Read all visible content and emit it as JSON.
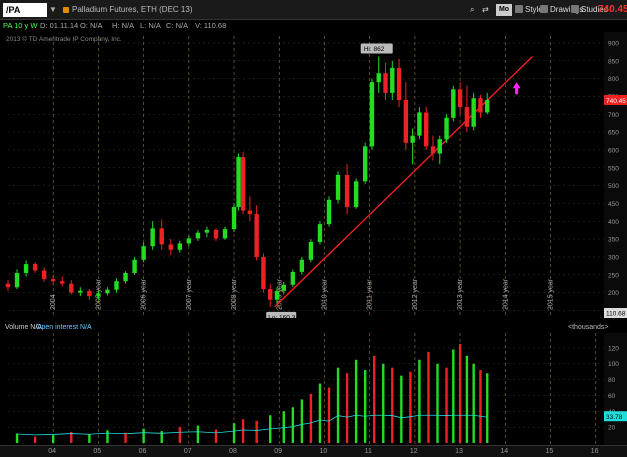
{
  "toolbar": {
    "symbol": "/PA",
    "title": "Palladium Futures, ETH (DEC 13)",
    "mo_label": "Mo",
    "style_label": "Style",
    "drawings_label": "Drawings",
    "studies_label": "Studies",
    "last_price": "740.45"
  },
  "info": {
    "period": "PA 10 y W",
    "date": "D: 01.11.14",
    "open": "O: N/A",
    "high": "H: N/A",
    "low": "L: N/A",
    "close": "C: N/A",
    "volume": "V: 110.68"
  },
  "copyright": "2013 © TD Ameritrade IP Company, Inc.",
  "colors": {
    "up": "#22dd22",
    "down": "#ee2222",
    "trendline": "#ff2222",
    "grid": "#8a6a2a",
    "arrow": "#ff22ff",
    "oi": "#22dddd"
  },
  "icons": [
    "search-icon",
    "share-icon",
    "style-icon",
    "drawings-icon",
    "studies-icon",
    "up-arrow-icon"
  ],
  "chart_data": [
    {
      "type": "candlestick",
      "x_labels": [
        "2004",
        "2005 year",
        "2006 year",
        "2007 year",
        "2008 year",
        "2009 year",
        "2010 year",
        "2011 year",
        "2012 year",
        "2013 year",
        "2014 year",
        "2015 year"
      ],
      "y_ticks": [
        900,
        850,
        800,
        750,
        700,
        650,
        600,
        550,
        500,
        450,
        400,
        350,
        300,
        250,
        200,
        150
      ],
      "ylim": [
        140,
        925
      ],
      "annotations": {
        "high": "Hi: 862",
        "low": "Lo: 160.3",
        "current": "740.45",
        "last_volume": "110.68"
      },
      "trendline": {
        "from": [
          2008.9,
          160
        ],
        "to": [
          2014.6,
          862
        ]
      },
      "candles": [
        {
          "t": 2003.0,
          "o": 225,
          "h": 235,
          "l": 205,
          "c": 215
        },
        {
          "t": 2003.2,
          "o": 215,
          "h": 265,
          "l": 210,
          "c": 255
        },
        {
          "t": 2003.4,
          "o": 255,
          "h": 290,
          "l": 245,
          "c": 280
        },
        {
          "t": 2003.6,
          "o": 280,
          "h": 285,
          "l": 255,
          "c": 262
        },
        {
          "t": 2003.8,
          "o": 262,
          "h": 270,
          "l": 230,
          "c": 238
        },
        {
          "t": 2004.0,
          "o": 238,
          "h": 250,
          "l": 220,
          "c": 232
        },
        {
          "t": 2004.2,
          "o": 232,
          "h": 245,
          "l": 218,
          "c": 225
        },
        {
          "t": 2004.4,
          "o": 225,
          "h": 235,
          "l": 195,
          "c": 200
        },
        {
          "t": 2004.6,
          "o": 200,
          "h": 215,
          "l": 190,
          "c": 205
        },
        {
          "t": 2004.8,
          "o": 205,
          "h": 210,
          "l": 180,
          "c": 190
        },
        {
          "t": 2005.0,
          "o": 190,
          "h": 205,
          "l": 180,
          "c": 198
        },
        {
          "t": 2005.2,
          "o": 198,
          "h": 215,
          "l": 192,
          "c": 208
        },
        {
          "t": 2005.4,
          "o": 208,
          "h": 240,
          "l": 200,
          "c": 232
        },
        {
          "t": 2005.6,
          "o": 232,
          "h": 260,
          "l": 225,
          "c": 255
        },
        {
          "t": 2005.8,
          "o": 255,
          "h": 300,
          "l": 250,
          "c": 292
        },
        {
          "t": 2006.0,
          "o": 292,
          "h": 340,
          "l": 285,
          "c": 330
        },
        {
          "t": 2006.2,
          "o": 330,
          "h": 400,
          "l": 320,
          "c": 380
        },
        {
          "t": 2006.4,
          "o": 380,
          "h": 405,
          "l": 320,
          "c": 335
        },
        {
          "t": 2006.6,
          "o": 335,
          "h": 350,
          "l": 305,
          "c": 320
        },
        {
          "t": 2006.8,
          "o": 320,
          "h": 345,
          "l": 312,
          "c": 338
        },
        {
          "t": 2007.0,
          "o": 338,
          "h": 360,
          "l": 330,
          "c": 352
        },
        {
          "t": 2007.2,
          "o": 352,
          "h": 375,
          "l": 345,
          "c": 368
        },
        {
          "t": 2007.4,
          "o": 368,
          "h": 385,
          "l": 355,
          "c": 376
        },
        {
          "t": 2007.6,
          "o": 376,
          "h": 380,
          "l": 345,
          "c": 352
        },
        {
          "t": 2007.8,
          "o": 352,
          "h": 385,
          "l": 348,
          "c": 378
        },
        {
          "t": 2008.0,
          "o": 378,
          "h": 450,
          "l": 370,
          "c": 440
        },
        {
          "t": 2008.1,
          "o": 440,
          "h": 590,
          "l": 430,
          "c": 580
        },
        {
          "t": 2008.2,
          "o": 580,
          "h": 595,
          "l": 420,
          "c": 430
        },
        {
          "t": 2008.35,
          "o": 430,
          "h": 470,
          "l": 400,
          "c": 420
        },
        {
          "t": 2008.5,
          "o": 420,
          "h": 445,
          "l": 290,
          "c": 300
        },
        {
          "t": 2008.65,
          "o": 300,
          "h": 310,
          "l": 200,
          "c": 210
        },
        {
          "t": 2008.8,
          "o": 210,
          "h": 225,
          "l": 160,
          "c": 180
        },
        {
          "t": 2008.95,
          "o": 180,
          "h": 215,
          "l": 170,
          "c": 205
        },
        {
          "t": 2009.1,
          "o": 205,
          "h": 230,
          "l": 195,
          "c": 222
        },
        {
          "t": 2009.3,
          "o": 222,
          "h": 265,
          "l": 215,
          "c": 258
        },
        {
          "t": 2009.5,
          "o": 258,
          "h": 300,
          "l": 250,
          "c": 292
        },
        {
          "t": 2009.7,
          "o": 292,
          "h": 350,
          "l": 285,
          "c": 342
        },
        {
          "t": 2009.9,
          "o": 342,
          "h": 400,
          "l": 335,
          "c": 392
        },
        {
          "t": 2010.1,
          "o": 392,
          "h": 470,
          "l": 385,
          "c": 460
        },
        {
          "t": 2010.3,
          "o": 460,
          "h": 540,
          "l": 450,
          "c": 530
        },
        {
          "t": 2010.5,
          "o": 530,
          "h": 560,
          "l": 420,
          "c": 440
        },
        {
          "t": 2010.7,
          "o": 440,
          "h": 520,
          "l": 435,
          "c": 512
        },
        {
          "t": 2010.9,
          "o": 512,
          "h": 620,
          "l": 505,
          "c": 610
        },
        {
          "t": 2011.05,
          "o": 610,
          "h": 800,
          "l": 600,
          "c": 790
        },
        {
          "t": 2011.2,
          "o": 790,
          "h": 862,
          "l": 760,
          "c": 815
        },
        {
          "t": 2011.35,
          "o": 815,
          "h": 845,
          "l": 740,
          "c": 760
        },
        {
          "t": 2011.5,
          "o": 760,
          "h": 850,
          "l": 740,
          "c": 830
        },
        {
          "t": 2011.65,
          "o": 830,
          "h": 855,
          "l": 720,
          "c": 740
        },
        {
          "t": 2011.8,
          "o": 740,
          "h": 790,
          "l": 600,
          "c": 620
        },
        {
          "t": 2011.95,
          "o": 620,
          "h": 660,
          "l": 560,
          "c": 640
        },
        {
          "t": 2012.1,
          "o": 640,
          "h": 720,
          "l": 630,
          "c": 705
        },
        {
          "t": 2012.25,
          "o": 705,
          "h": 720,
          "l": 600,
          "c": 610
        },
        {
          "t": 2012.4,
          "o": 610,
          "h": 640,
          "l": 570,
          "c": 590
        },
        {
          "t": 2012.55,
          "o": 590,
          "h": 640,
          "l": 560,
          "c": 630
        },
        {
          "t": 2012.7,
          "o": 630,
          "h": 700,
          "l": 620,
          "c": 690
        },
        {
          "t": 2012.85,
          "o": 690,
          "h": 780,
          "l": 680,
          "c": 770
        },
        {
          "t": 2013.0,
          "o": 770,
          "h": 790,
          "l": 700,
          "c": 720
        },
        {
          "t": 2013.15,
          "o": 720,
          "h": 780,
          "l": 650,
          "c": 665
        },
        {
          "t": 2013.3,
          "o": 665,
          "h": 760,
          "l": 655,
          "c": 745
        },
        {
          "t": 2013.45,
          "o": 745,
          "h": 755,
          "l": 690,
          "c": 705
        },
        {
          "t": 2013.6,
          "o": 705,
          "h": 760,
          "l": 700,
          "c": 740
        }
      ]
    },
    {
      "type": "bar",
      "title": "Volume",
      "series_labels": [
        "Volume N/A",
        "Open interest N/A"
      ],
      "unit_label": "<thousands>",
      "y_ticks": [
        120,
        100,
        80,
        60,
        40,
        20
      ],
      "ylim": [
        0,
        135
      ],
      "x_labels": [
        "04",
        "05",
        "06",
        "07",
        "08",
        "09",
        "10",
        "11",
        "12",
        "13",
        "14",
        "15",
        "16"
      ],
      "last_value": "33.78",
      "values": [
        {
          "t": 2003.2,
          "v": 12,
          "up": true
        },
        {
          "t": 2003.6,
          "v": 8,
          "up": false
        },
        {
          "t": 2004.0,
          "v": 10,
          "up": true
        },
        {
          "t": 2004.4,
          "v": 14,
          "up": false
        },
        {
          "t": 2004.8,
          "v": 11,
          "up": true
        },
        {
          "t": 2005.2,
          "v": 16,
          "up": true
        },
        {
          "t": 2005.6,
          "v": 13,
          "up": false
        },
        {
          "t": 2006.0,
          "v": 18,
          "up": true
        },
        {
          "t": 2006.4,
          "v": 15,
          "up": true
        },
        {
          "t": 2006.8,
          "v": 20,
          "up": false
        },
        {
          "t": 2007.2,
          "v": 22,
          "up": true
        },
        {
          "t": 2007.6,
          "v": 17,
          "up": false
        },
        {
          "t": 2008.0,
          "v": 25,
          "up": true
        },
        {
          "t": 2008.2,
          "v": 30,
          "up": false
        },
        {
          "t": 2008.5,
          "v": 28,
          "up": false
        },
        {
          "t": 2008.8,
          "v": 35,
          "up": true
        },
        {
          "t": 2009.1,
          "v": 40,
          "up": true
        },
        {
          "t": 2009.3,
          "v": 45,
          "up": true
        },
        {
          "t": 2009.5,
          "v": 55,
          "up": true
        },
        {
          "t": 2009.7,
          "v": 62,
          "up": false
        },
        {
          "t": 2009.9,
          "v": 75,
          "up": true
        },
        {
          "t": 2010.1,
          "v": 70,
          "up": false
        },
        {
          "t": 2010.3,
          "v": 95,
          "up": true
        },
        {
          "t": 2010.5,
          "v": 88,
          "up": false
        },
        {
          "t": 2010.7,
          "v": 105,
          "up": true
        },
        {
          "t": 2010.9,
          "v": 92,
          "up": true
        },
        {
          "t": 2011.1,
          "v": 110,
          "up": false
        },
        {
          "t": 2011.3,
          "v": 100,
          "up": true
        },
        {
          "t": 2011.5,
          "v": 95,
          "up": false
        },
        {
          "t": 2011.7,
          "v": 85,
          "up": true
        },
        {
          "t": 2011.9,
          "v": 90,
          "up": false
        },
        {
          "t": 2012.1,
          "v": 105,
          "up": true
        },
        {
          "t": 2012.3,
          "v": 115,
          "up": false
        },
        {
          "t": 2012.5,
          "v": 100,
          "up": true
        },
        {
          "t": 2012.7,
          "v": 95,
          "up": false
        },
        {
          "t": 2012.85,
          "v": 118,
          "up": true
        },
        {
          "t": 2013.0,
          "v": 125,
          "up": false
        },
        {
          "t": 2013.15,
          "v": 110,
          "up": true
        },
        {
          "t": 2013.3,
          "v": 100,
          "up": true
        },
        {
          "t": 2013.45,
          "v": 92,
          "up": false
        },
        {
          "t": 2013.6,
          "v": 88,
          "up": true
        }
      ]
    }
  ]
}
